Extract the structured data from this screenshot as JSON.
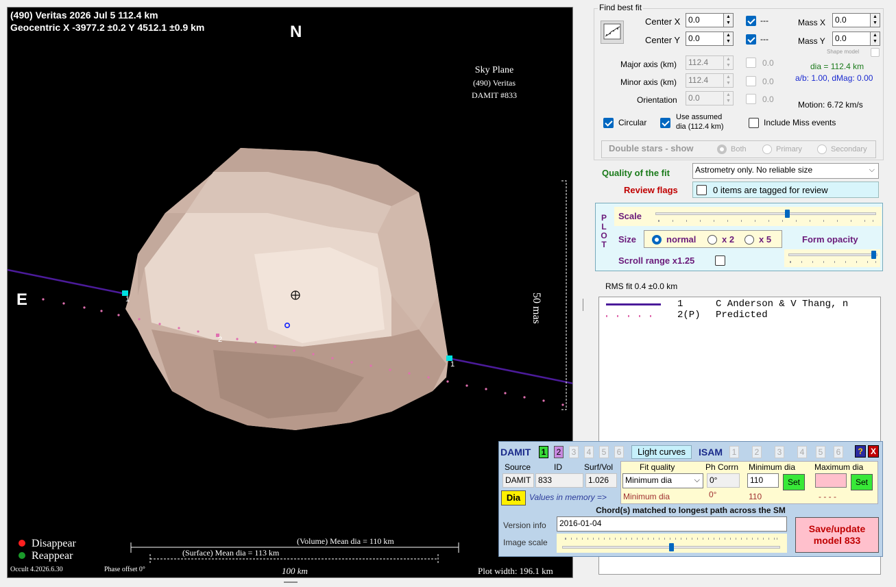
{
  "plot": {
    "title_line1": "(490) Veritas  2026 Jul 5  112.4 km",
    "title_line2": "Geocentric X  -3977.2 ±0.2  Y 4512.1 ±0.9 km",
    "north_label": "N",
    "east_label": "E",
    "sky_plane_title": "Sky Plane",
    "sky_plane_object": "(490) Veritas",
    "sky_plane_model": "DAMIT #833",
    "scale_label": "50 mas",
    "chord1_label_left": "1",
    "chord1_label_right": "1",
    "chord2_label": "2",
    "legend_disappear": "Disappear",
    "legend_reappear": "Reappear",
    "legend_disappear_color": "#ff2020",
    "legend_reappear_color": "#1a9a2a",
    "volume_mean_dia": "(Volume) Mean dia = 110 km",
    "surface_mean_dia": "(Surface) Mean dia = 113 km",
    "scale_bar_label": "100 km",
    "version": "Occult 4.2026.6.30",
    "phase_offset": "Phase offset 0°",
    "plot_width": "Plot width: 196.1 km",
    "chord1_color": "#4b1b9a",
    "chord2_color": "#e070b0",
    "marker_color": "#00e0e0"
  },
  "fit": {
    "group_title": "Find best fit",
    "center_x_label": "Center X",
    "center_x_value": "0.0",
    "center_y_label": "Center Y",
    "center_y_value": "0.0",
    "center_x_lock": "---",
    "center_y_lock": "---",
    "mass_x_label": "Mass X",
    "mass_x_value": "0.0",
    "mass_y_label": "Mass Y",
    "mass_y_value": "0.0",
    "shape_model_label": "Shape model",
    "major_axis_label": "Major axis (km)",
    "major_axis_value": "112.4",
    "major_axis_fix": "0.0",
    "minor_axis_label": "Minor axis (km)",
    "minor_axis_value": "112.4",
    "minor_axis_fix": "0.0",
    "orientation_label": "Orientation",
    "orientation_value": "0.0",
    "orientation_fix": "0.0",
    "dia_text": "dia = 112.4 km",
    "ab_text": "a/b: 1.00, dMag: 0.00",
    "motion_text": "Motion: 6.72 km/s",
    "circular_label": "Circular",
    "use_assumed_line1": "Use assumed",
    "use_assumed_line2": "dia (112.4 km)",
    "include_miss_label": "Include Miss events",
    "double_stars_label": "Double stars - show",
    "both_label": "Both",
    "primary_label": "Primary",
    "secondary_label": "Secondary",
    "quality_label": "Quality of the fit",
    "quality_value": "Astrometry only. No reliable size",
    "review_flags_label": "Review flags",
    "review_flags_text": "0 items are tagged for review"
  },
  "plotctl": {
    "plot_vertical": "PLOT",
    "scale_label": "Scale",
    "size_label": "Size",
    "size_normal": "normal",
    "size_x2": "x 2",
    "size_x5": "x 5",
    "form_opacity_label": "Form opacity",
    "scroll_range_label": "Scroll range x1.25",
    "scale_level": 0.6,
    "opacity_level": 0.98
  },
  "rms": "RMS fit 0.4 ±0.0 km",
  "legend_list": [
    {
      "num": "1",
      "name": "C Anderson & V Thang, n"
    },
    {
      "num": "2(P)",
      "name": "Predicted"
    }
  ],
  "damit": {
    "damit_label": "DAMIT",
    "damit_nums": [
      "1",
      "2",
      "3",
      "4",
      "5",
      "6"
    ],
    "light_curves": "Light curves",
    "isam_label": "ISAM",
    "isam_nums": [
      "1",
      "2",
      "3",
      "4",
      "5",
      "6"
    ],
    "help": "?",
    "close": "X",
    "source_hdr": "Source",
    "id_hdr": "ID",
    "surfvol_hdr": "Surf/Vol",
    "source_val": "DAMIT",
    "id_val": "833",
    "surfvol_val": "1.026",
    "fit_quality_hdr": "Fit quality",
    "ph_corr_hdr": "Ph Corrn",
    "min_dia_hdr": "Minimum dia",
    "max_dia_hdr": "Maximum dia",
    "fit_quality_val": "Minimum dia",
    "ph_corr_val": "0°",
    "min_dia_val": "110",
    "set_label": "Set",
    "dia_btn": "Dia",
    "values_in_memory": "Values in memory =>",
    "mem_fit_quality": "Minimum dia",
    "mem_ph_corr": "0°",
    "mem_min_dia": "110",
    "mem_max_dia": "- - - -",
    "chord_match": "Chord(s) matched to longest path across the SM",
    "version_label": "Version info",
    "version_val": "2016-01-04",
    "image_scale_label": "Image scale",
    "image_scale_level": 0.5,
    "save_line1": "Save/update",
    "save_line2": "model 833"
  }
}
